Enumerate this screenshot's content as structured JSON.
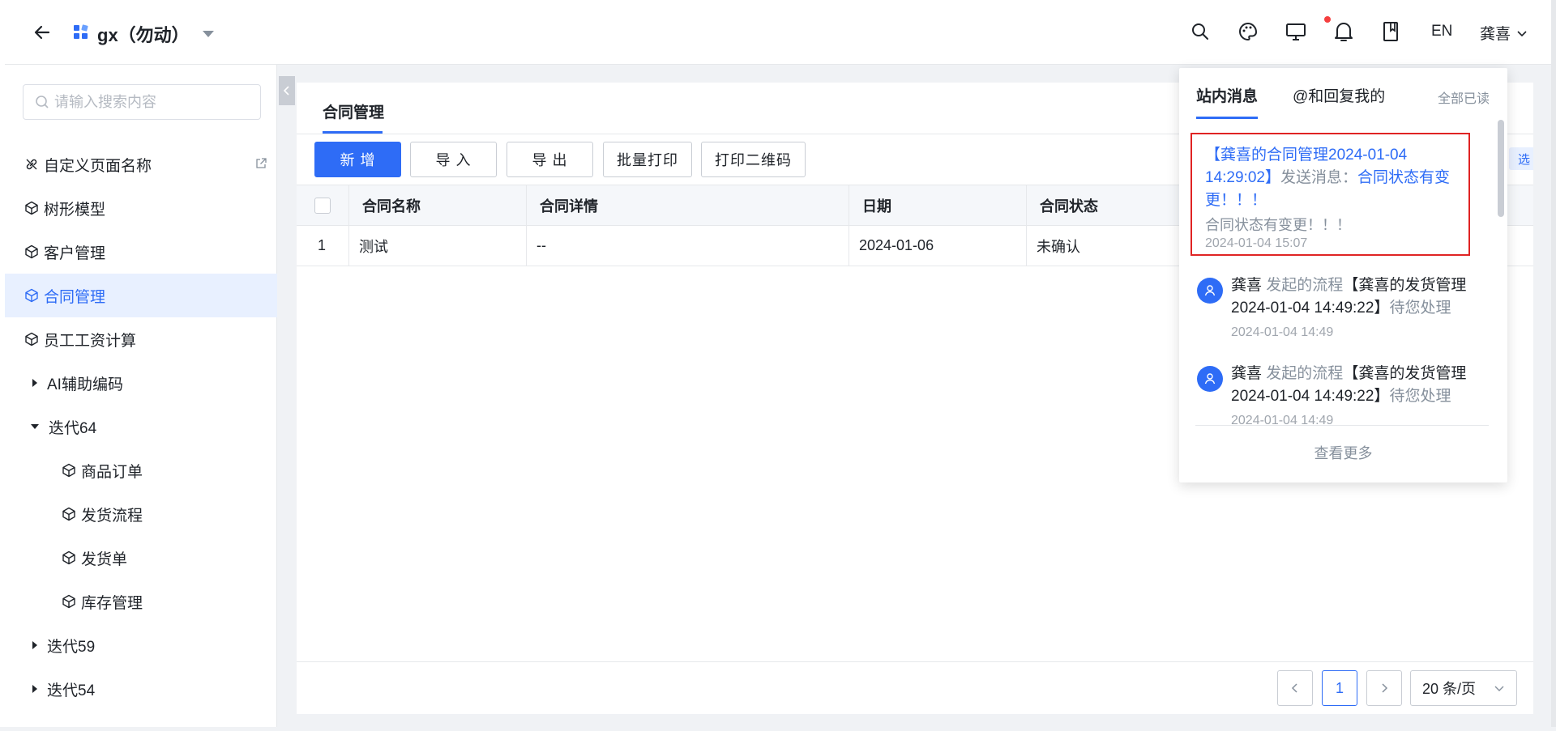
{
  "header": {
    "app_title": "gx（勿动）",
    "lang": "EN",
    "user": "龚喜",
    "icons": [
      "search-icon",
      "palette-icon",
      "monitor-icon",
      "bell-icon",
      "book-icon"
    ]
  },
  "sidebar": {
    "search_placeholder": "请输入搜索内容",
    "items": [
      {
        "label": "自定义页面名称",
        "icon": "link-icon"
      },
      {
        "label": "树形模型",
        "icon": "cube-icon"
      },
      {
        "label": "客户管理",
        "icon": "cube-icon"
      },
      {
        "label": "合同管理",
        "icon": "cube-icon"
      },
      {
        "label": "员工工资计算",
        "icon": "cube-icon"
      },
      {
        "label": "AI辅助编码"
      },
      {
        "label": "迭代64"
      },
      {
        "label": "商品订单",
        "icon": "cube-icon"
      },
      {
        "label": "发货流程",
        "icon": "cube-icon"
      },
      {
        "label": "发货单",
        "icon": "cube-icon"
      },
      {
        "label": "库存管理",
        "icon": "cube-icon"
      },
      {
        "label": "迭代59"
      },
      {
        "label": "迭代54"
      }
    ]
  },
  "main": {
    "tab_title": "合同管理",
    "buttons": {
      "add": "新 增",
      "import": "导 入",
      "export": "导 出",
      "batch_print": "批量打印",
      "print_qr": "打印二维码"
    },
    "filter_chip": "选",
    "table": {
      "columns": [
        "合同名称",
        "合同详情",
        "日期",
        "合同状态"
      ],
      "rows": [
        {
          "index": "1",
          "name": "测试",
          "detail": "--",
          "date": "2024-01-06",
          "status": "未确认"
        }
      ]
    },
    "pager": {
      "current_page": "1",
      "page_size": "20 条/页"
    }
  },
  "notifications": {
    "tab_inbox": "站内消息",
    "tab_mentions": "@和回复我的",
    "mark_all_read": "全部已读",
    "highlighted": {
      "title_blue": "【龚喜的合同管理2024-01-04 14:29:02】",
      "title_mid": "发送消息：",
      "title_end": "合同状态有变更！！！",
      "subtitle": "合同状态有变更！！！",
      "time": "2024-01-04 15:07"
    },
    "items": [
      {
        "sender": "龚喜",
        "action": "发起的流程",
        "subject": "【龚喜的发货管理2024-01-04 14:49:22】",
        "suffix": "待您处理",
        "time": "2024-01-04 14:49"
      },
      {
        "sender": "龚喜",
        "action": "发起的流程",
        "subject": "【龚喜的发货管理2024-01-04 14:49:22】",
        "suffix": "待您处理",
        "time": "2024-01-04 14:49"
      }
    ],
    "view_more": "查看更多"
  },
  "colors": {
    "accent": "#2e6cf6",
    "highlight_border": "#e02424",
    "notification_dot": "#f53f3f"
  }
}
